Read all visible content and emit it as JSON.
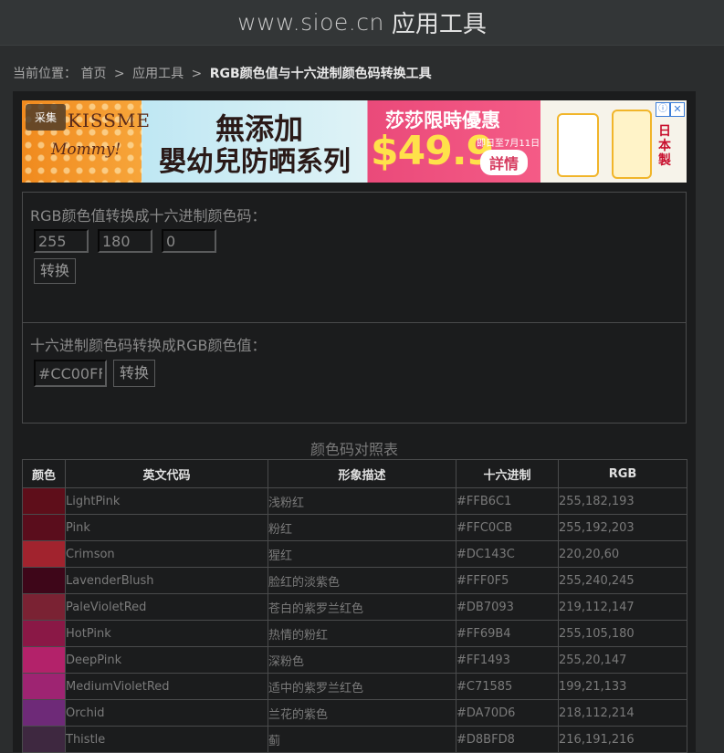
{
  "header": {
    "domain": "www.sioe.cn",
    "app": "应用工具"
  },
  "breadcrumb": {
    "prefix": "当前位置：",
    "home": "首页",
    "sep": ">",
    "section": "应用工具",
    "current": "RGB颜色值与十六进制颜色码转换工具"
  },
  "ad": {
    "tag": "采集",
    "brand_line1": "KISSME",
    "brand_line2": "Mommy!",
    "headline1": "無添加",
    "headline2": "嬰幼兒防晒系列",
    "sale": "莎莎限時優惠",
    "price": "$49.9",
    "date": "即日至7月11日",
    "detail": "詳情",
    "origin": "日本製",
    "info_icon": "ⓘ",
    "close_icon": "✕"
  },
  "rgb_to_hex": {
    "title": "RGB颜色值转换成十六进制颜色码：",
    "r": "255",
    "g": "180",
    "b": "0",
    "button": "转换"
  },
  "hex_to_rgb": {
    "title": "十六进制颜色码转换成RGB颜色值：",
    "hex": "#CC00FF",
    "button": "转换"
  },
  "table": {
    "title": "颜色码对照表",
    "headers": [
      "颜色",
      "英文代码",
      "形象描述",
      "十六进制",
      "RGB"
    ],
    "rows": [
      {
        "swatch": "#5e0e1a",
        "name": "LightPink",
        "desc": "浅粉红",
        "hex": "#FFB6C1",
        "rgb": "255,182,193"
      },
      {
        "swatch": "#5a0d1c",
        "name": "Pink",
        "desc": "粉红",
        "hex": "#FFC0CB",
        "rgb": "255,192,203"
      },
      {
        "swatch": "#a1232e",
        "name": "Crimson",
        "desc": "猩红",
        "hex": "#DC143C",
        "rgb": "220,20,60"
      },
      {
        "swatch": "#3e0619",
        "name": "LavenderBlush",
        "desc": "脸红的淡紫色",
        "hex": "#FFF0F5",
        "rgb": "255,240,245"
      },
      {
        "swatch": "#7a2233",
        "name": "PaleVioletRed",
        "desc": "苍白的紫罗兰红色",
        "hex": "#DB7093",
        "rgb": "219,112,147"
      },
      {
        "swatch": "#8a1846",
        "name": "HotPink",
        "desc": "热情的粉红",
        "hex": "#FF69B4",
        "rgb": "255,105,180"
      },
      {
        "swatch": "#b3226a",
        "name": "DeepPink",
        "desc": "深粉色",
        "hex": "#FF1493",
        "rgb": "255,20,147"
      },
      {
        "swatch": "#9e2472",
        "name": "MediumVioletRed",
        "desc": "适中的紫罗兰红色",
        "hex": "#C71585",
        "rgb": "199,21,133"
      },
      {
        "swatch": "#6e2a78",
        "name": "Orchid",
        "desc": "兰花的紫色",
        "hex": "#DA70D6",
        "rgb": "218,112,214"
      },
      {
        "swatch": "#3e2840",
        "name": "Thistle",
        "desc": "蓟",
        "hex": "#D8BFD8",
        "rgb": "216,191,216"
      }
    ]
  }
}
